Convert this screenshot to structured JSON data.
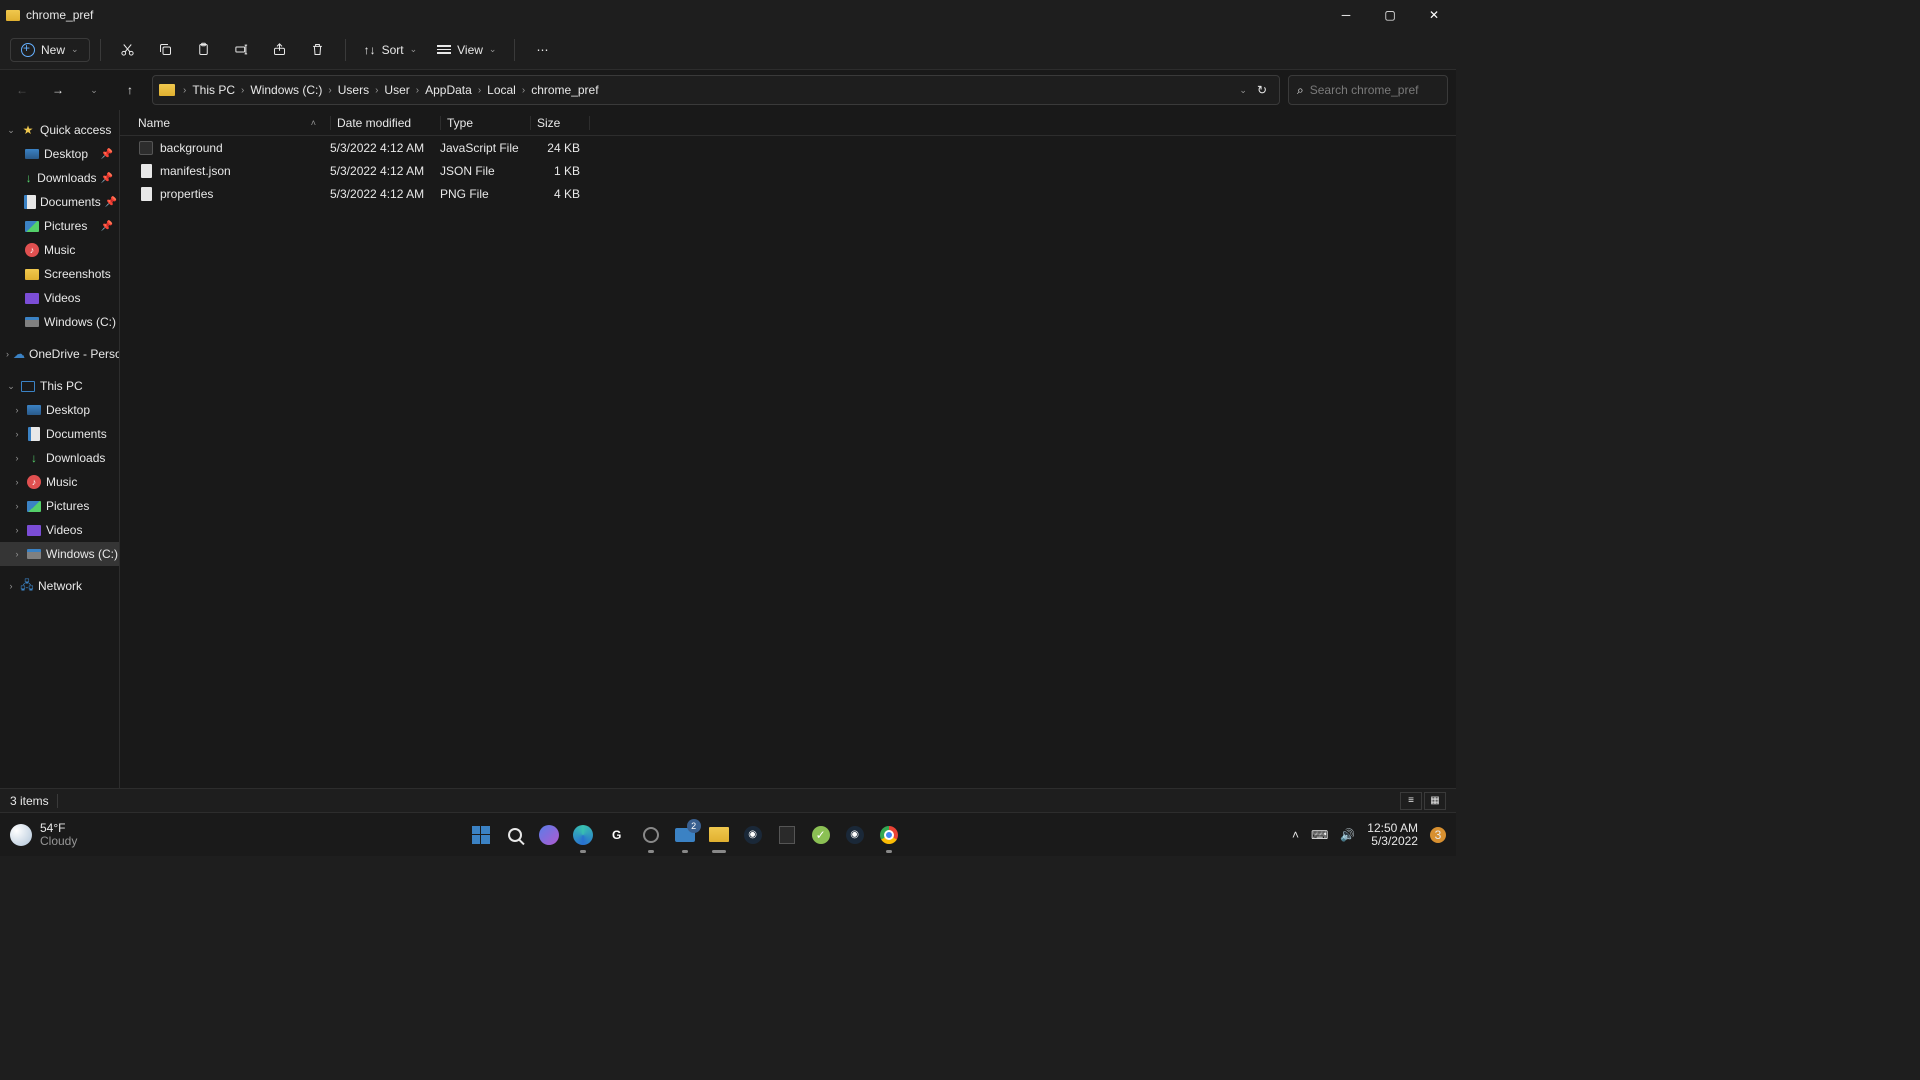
{
  "window": {
    "title": "chrome_pref"
  },
  "toolbar": {
    "new": "New",
    "sort": "Sort",
    "view": "View"
  },
  "breadcrumb": [
    "This PC",
    "Windows (C:)",
    "Users",
    "User",
    "AppData",
    "Local",
    "chrome_pref"
  ],
  "search": {
    "placeholder": "Search chrome_pref"
  },
  "nav": {
    "quick_access": "Quick access",
    "desktop": "Desktop",
    "downloads": "Downloads",
    "documents": "Documents",
    "pictures": "Pictures",
    "music": "Music",
    "screenshots": "Screenshots",
    "videos": "Videos",
    "windows_c": "Windows (C:)",
    "onedrive": "OneDrive - Personal",
    "this_pc": "This PC",
    "network": "Network"
  },
  "columns": {
    "name": "Name",
    "date": "Date modified",
    "type": "Type",
    "size": "Size"
  },
  "files": [
    {
      "name": "background",
      "date": "5/3/2022 4:12 AM",
      "type": "JavaScript File",
      "size": "24 KB",
      "icon": "js"
    },
    {
      "name": "manifest.json",
      "date": "5/3/2022 4:12 AM",
      "type": "JSON File",
      "size": "1 KB",
      "icon": "json"
    },
    {
      "name": "properties",
      "date": "5/3/2022 4:12 AM",
      "type": "PNG File",
      "size": "4 KB",
      "icon": "png"
    }
  ],
  "status": {
    "items": "3 items"
  },
  "taskbar": {
    "weather_temp": "54°F",
    "weather_cond": "Cloudy",
    "mail_badge": "2",
    "time": "12:50 AM",
    "date": "5/3/2022",
    "notif": "3"
  }
}
